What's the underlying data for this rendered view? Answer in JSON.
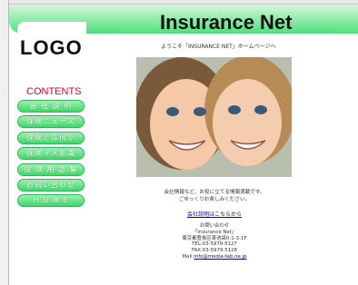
{
  "header": {
    "logo_text": "LOGO",
    "title": "Insurance Net",
    "welcome": "ようこそ「INSURANCE NET」ホームページへ"
  },
  "colors": {
    "accent_green": "#4fe07a",
    "contents_red": "#e8001e",
    "link_blue": "#0000cc"
  },
  "sidebar": {
    "contents_label": "CONTENTS",
    "items": [
      {
        "label": "会 社 説 明"
      },
      {
        "label": "保険ニュース"
      },
      {
        "label": "保険とは何か"
      },
      {
        "label": "保険マメ知識"
      },
      {
        "label": "保 険 用 語 集"
      },
      {
        "label": "お問い合わせ"
      },
      {
        "label": "H O M E"
      }
    ]
  },
  "main": {
    "info_line1": "会社情報など、お役に立てる情報満載です。",
    "info_line2": "ごゆっくりお楽しみください。",
    "link_text": "会社説明はこちらから",
    "contact": {
      "heading": "お問い合わせ",
      "company": "「Insurance Net」",
      "address": "東京都豊島区東池袋0-1-3-1F",
      "tel": "TEL:03-5979-5127",
      "fax": "FAX:03-5979-5128",
      "mail_label": "Mail:",
      "mail_address": "info@media-tab.ne.jp"
    }
  }
}
